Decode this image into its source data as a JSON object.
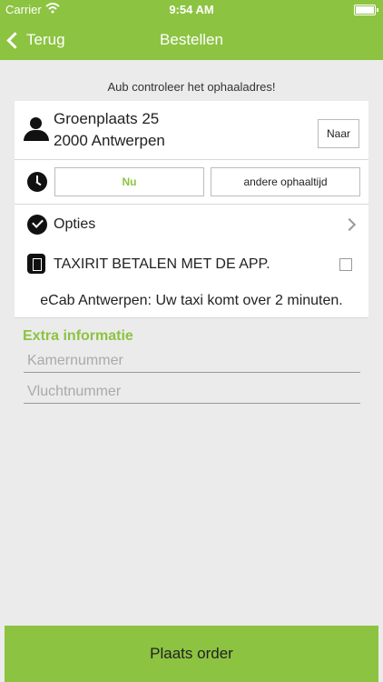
{
  "status_bar": {
    "carrier": "Carrier",
    "time": "9:54 AM"
  },
  "nav": {
    "back_label": "Terug",
    "title": "Bestellen"
  },
  "hint": "Aub controleer het ophaaladres!",
  "address": {
    "line1": "Groenplaats 25",
    "line2": "2000 Antwerpen",
    "to_button": "Naar"
  },
  "pickup_time": {
    "now_label": "Nu",
    "other_label": "andere ophaaltijd"
  },
  "options": {
    "label": "Opties"
  },
  "payment": {
    "label": "TAXIRIT BETALEN MET DE APP.",
    "checked": false
  },
  "info": "eCab Antwerpen: Uw taxi komt over 2 minuten.",
  "extra": {
    "title": "Extra informatie",
    "room_placeholder": "Kamernummer",
    "flight_placeholder": "Vluchtnummer",
    "room_value": "",
    "flight_value": ""
  },
  "order_button": "Plaats order",
  "colors": {
    "accent": "#8cc341",
    "background": "#ebebeb"
  },
  "icons": [
    "wifi-icon",
    "battery-icon",
    "chevron-left-icon",
    "person-icon",
    "clock-icon",
    "check-circle-icon",
    "chevron-right-icon",
    "phone-icon"
  ]
}
